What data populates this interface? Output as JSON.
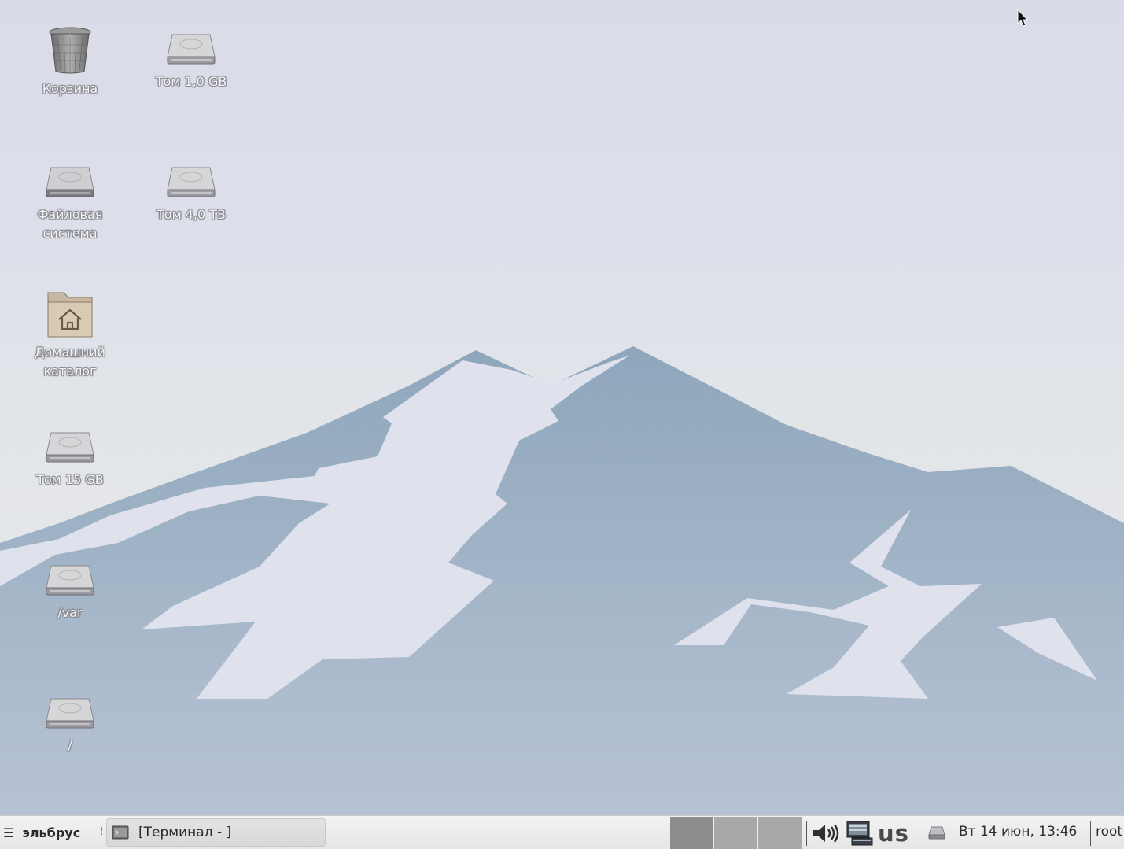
{
  "desktop": {
    "icons": [
      {
        "name": "trash",
        "label": "Корзина",
        "icon": "trash-icon"
      },
      {
        "name": "volume-1gb",
        "label": "Том 1,0 GB",
        "icon": "drive-icon"
      },
      {
        "name": "filesystem",
        "label": "Файловая система",
        "icon": "drive-icon"
      },
      {
        "name": "volume-4tb",
        "label": "Том 4,0 TB",
        "icon": "drive-icon"
      },
      {
        "name": "home",
        "label": "Домашний каталог",
        "icon": "home-folder-icon"
      },
      {
        "name": "volume-15gb",
        "label": "Том 15 GB",
        "icon": "drive-icon"
      },
      {
        "name": "var",
        "label": "/var",
        "icon": "drive-icon"
      },
      {
        "name": "root",
        "label": "/",
        "icon": "drive-icon"
      }
    ],
    "wallpaper": "mountain-elbrus"
  },
  "taskbar": {
    "start_label": "эльбрус",
    "start_icon": "menu-icon",
    "separator": "⁞",
    "tasks": [
      {
        "label": "[Терминал - ]",
        "icon": "terminal-icon"
      }
    ],
    "workspaces": [
      {
        "active": true
      },
      {
        "active": false
      },
      {
        "active": false
      }
    ],
    "tray": {
      "volume_icon": "speaker-icon",
      "network_icon": "network-icon",
      "keyboard_layout": "us",
      "drive_icon": "removable-drive-icon"
    },
    "clock": "Вт 14 июн, 13:46",
    "user": "root"
  },
  "colors": {
    "mountain": "#9aafc3",
    "snow": "#dfe2ec",
    "taskbar": "#ebebeb",
    "workspace_active": "#8d8d8d",
    "workspace_inactive": "#a8a8a8"
  }
}
